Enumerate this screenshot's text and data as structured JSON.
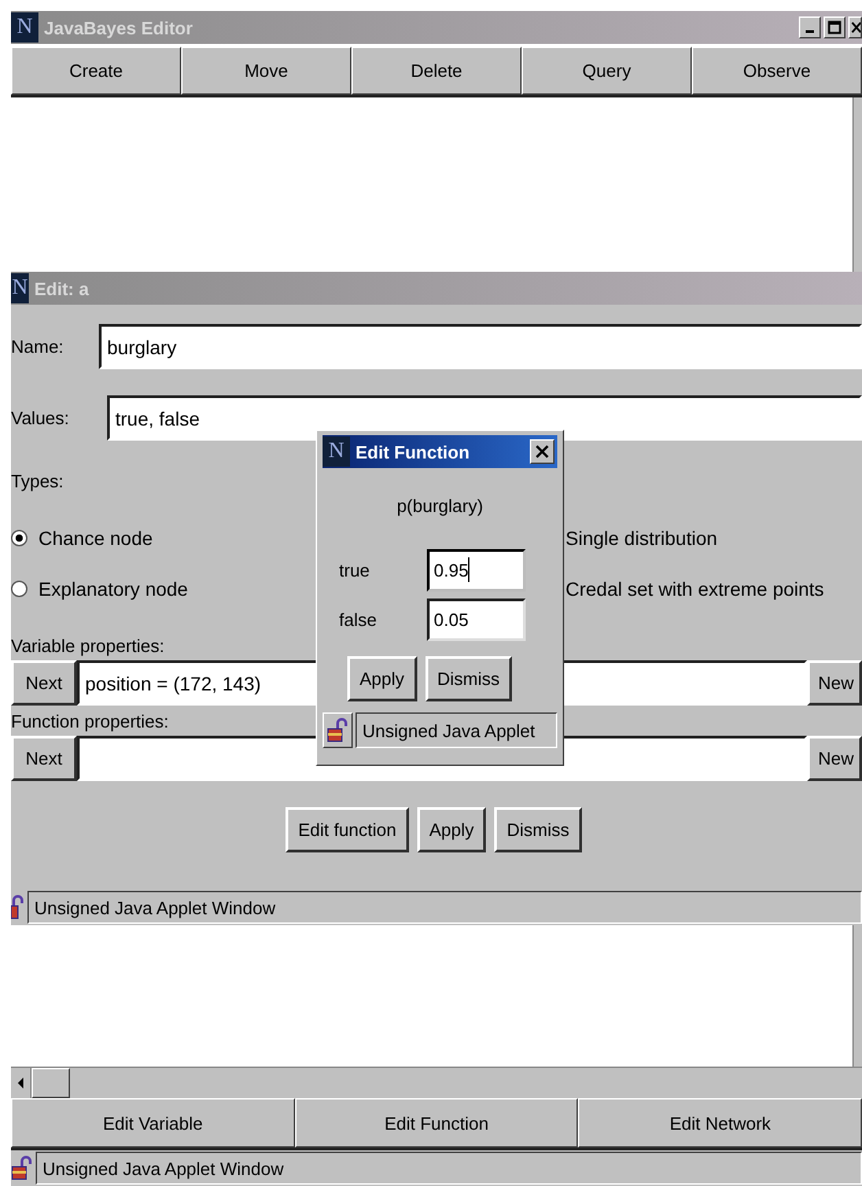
{
  "main_window": {
    "logo": "N",
    "title": "JavaBayes Editor",
    "modes": [
      "Create",
      "Move",
      "Delete",
      "Query",
      "Observe"
    ],
    "bottom_buttons": [
      "Edit Variable",
      "Edit Function",
      "Edit Network"
    ],
    "status": "Unsigned Java Applet Window"
  },
  "edit_dialog": {
    "logo": "N",
    "title": "Edit: a",
    "name_label": "Name:",
    "name_value": "burglary",
    "values_label": "Values:",
    "values_value": "true, false",
    "types_label": "Types:",
    "types": [
      {
        "label": "Chance node",
        "selected": true
      },
      {
        "label": "Explanatory node",
        "selected": false
      }
    ],
    "distribution_options": [
      "Single distribution",
      "Credal set with extreme points"
    ],
    "variable_properties": {
      "label": "Variable properties:",
      "next": "Next",
      "value": "position = (172, 143)",
      "new": "New"
    },
    "function_properties": {
      "label": "Function properties:",
      "next": "Next",
      "new": "New"
    },
    "buttons": [
      "Edit function",
      "Apply",
      "Dismiss"
    ],
    "status": "Unsigned Java Applet Window"
  },
  "edit_function_dialog": {
    "logo": "N",
    "title": "Edit Function",
    "heading": "p(burglary)",
    "entries": [
      {
        "label": "true",
        "value": "0.95",
        "focused": true
      },
      {
        "label": "false",
        "value": "0.05",
        "focused": false
      }
    ],
    "buttons": [
      "Apply",
      "Dismiss"
    ],
    "status": "Unsigned Java Applet"
  }
}
